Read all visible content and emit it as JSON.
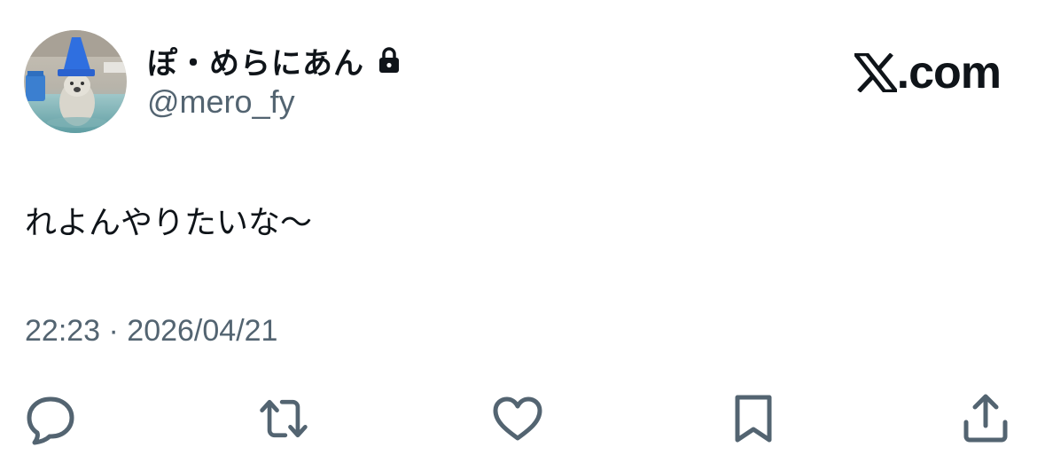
{
  "user": {
    "display_name": "ぽ・めらにあん",
    "handle": "@mero_fy",
    "protected_icon": "lock-icon",
    "avatar_description_icon": "avatar"
  },
  "brand": {
    "logo_icon": "x-logo-icon",
    "text": ".com"
  },
  "tweet": {
    "text": "れよんやりたいな〜",
    "timestamp": "22:23 · 2026/04/21"
  },
  "actions": [
    {
      "name": "reply",
      "icon": "speech-bubble-icon"
    },
    {
      "name": "repost",
      "icon": "repost-icon"
    },
    {
      "name": "like",
      "icon": "heart-icon"
    },
    {
      "name": "bookmark",
      "icon": "bookmark-icon"
    },
    {
      "name": "share",
      "icon": "share-icon"
    }
  ],
  "colors": {
    "text_primary": "#0f1419",
    "text_secondary": "#536471",
    "icon": "#536471",
    "background": "#ffffff"
  }
}
